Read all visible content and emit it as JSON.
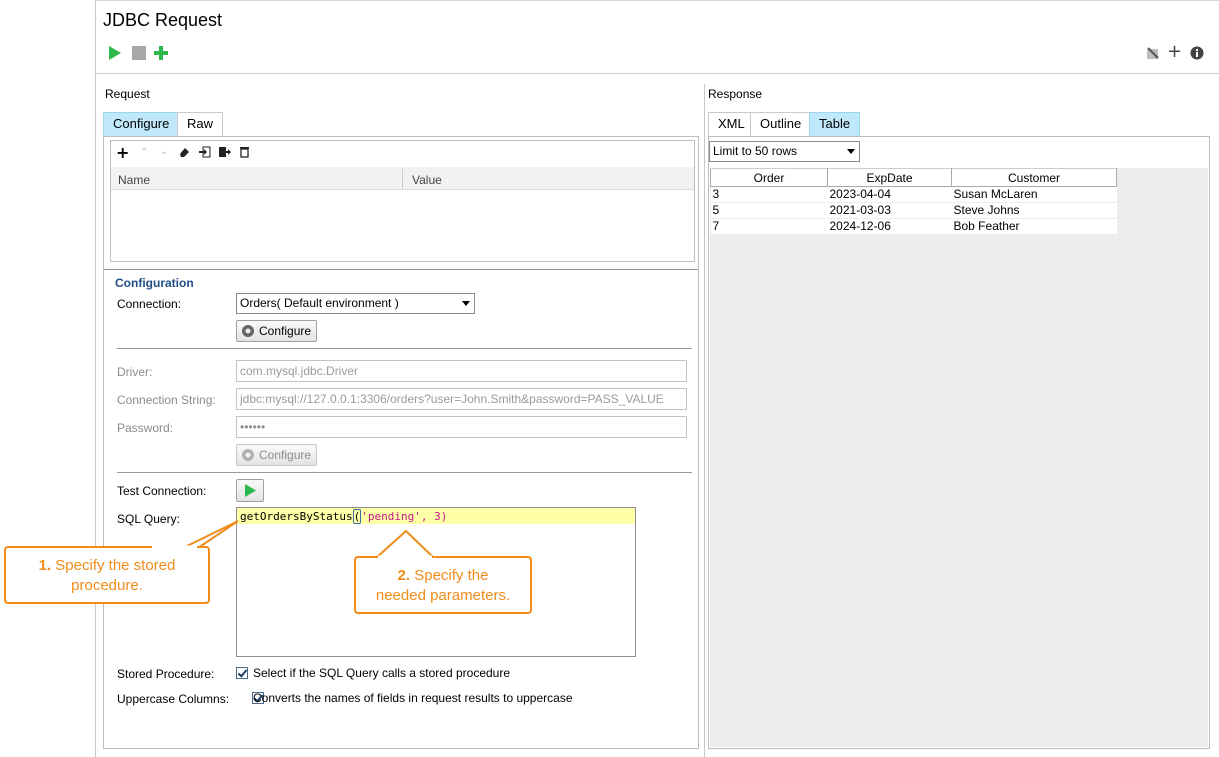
{
  "window": {
    "title": "JDBC Request"
  },
  "toolbar": {
    "run_icon": "play-icon",
    "stop_icon": "stop-icon",
    "add_icon": "plus-icon"
  },
  "right_toolbar": {
    "icons": [
      "tools-icon",
      "plus-icon",
      "info-icon"
    ]
  },
  "request": {
    "label": "Request",
    "tabs": [
      {
        "label": "Configure",
        "active": true
      },
      {
        "label": "Raw",
        "active": false
      }
    ],
    "params_table": {
      "columns": [
        "Name",
        "Value"
      ]
    },
    "configuration": {
      "heading": "Configuration",
      "connection_label": "Connection:",
      "connection_value": "Orders( Default environment )",
      "configure_button": "Configure",
      "driver_label": "Driver:",
      "driver_value": "com.mysql.jdbc.Driver",
      "connstr_label": "Connection String:",
      "connstr_value": "jdbc:mysql://127.0.0.1:3306/orders?user=John.Smith&password=PASS_VALUE",
      "password_label": "Password:",
      "password_value": "••••••",
      "configure_button_disabled": "Configure",
      "test_label": "Test Connection:",
      "sql_label": "SQL Query:",
      "sql_query": {
        "func": "getOrdersByStatus",
        "open": "(",
        "arg1": "'pending'",
        "rest": ", 3)"
      },
      "stored_label": "Stored Procedure:",
      "stored_text": "Select if the SQL Query calls a stored procedure",
      "uppercase_label": "Uppercase Columns:",
      "uppercase_text": "Converts the names of fields in request results to uppercase"
    }
  },
  "response": {
    "label": "Response",
    "tabs": [
      {
        "label": "XML",
        "active": false
      },
      {
        "label": "Outline",
        "active": false
      },
      {
        "label": "Table",
        "active": true
      }
    ],
    "limit_select": "Limit to 50 rows",
    "columns": [
      "Order",
      "ExpDate",
      "Customer"
    ],
    "rows": [
      [
        "3",
        "2023-04-04",
        "Susan McLaren"
      ],
      [
        "5",
        "2021-03-03",
        "Steve Johns"
      ],
      [
        "7",
        "2024-12-06",
        "Bob Feather"
      ]
    ]
  },
  "callouts": {
    "c1": {
      "num": "1.",
      "text": "Specify the stored procedure."
    },
    "c2": {
      "num": "2.",
      "text": "Specify the needed parameters."
    }
  },
  "colors": {
    "accent_tab": "#bfe8fb",
    "callout": "#f08c1a",
    "run_green": "#2db84d",
    "query_highlight": "#ffffa8"
  }
}
